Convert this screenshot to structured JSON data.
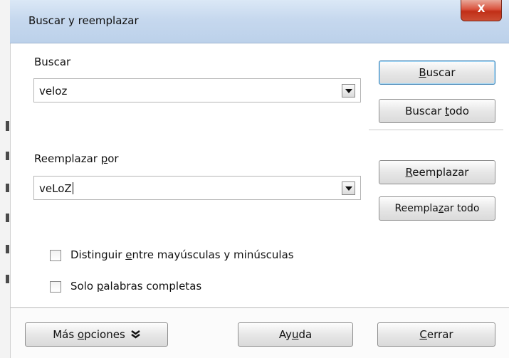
{
  "window": {
    "title": "Buscar y reemplazar",
    "close_glyph": "X"
  },
  "search": {
    "label_before": "Buscar",
    "value": "veloz"
  },
  "replace": {
    "label_before": "Reemplazar ",
    "label_accel": "p",
    "label_after": "or",
    "value": "veLoZ"
  },
  "buttons": {
    "find": {
      "before": "",
      "accel": "B",
      "after": "uscar"
    },
    "find_all": {
      "before": "Buscar ",
      "accel": "t",
      "after": "odo"
    },
    "replace": {
      "before": "",
      "accel": "R",
      "after": "eemplazar"
    },
    "replace_all": {
      "before": "Reempla",
      "accel": "z",
      "after": "ar todo"
    }
  },
  "options": {
    "match_case": {
      "before": "Distinguir ",
      "accel": "e",
      "after": "ntre mayúsculas y minúsculas",
      "checked": false
    },
    "whole_words": {
      "before": "Solo ",
      "accel": "p",
      "after": "alabras completas",
      "checked": false
    }
  },
  "footer": {
    "more_options": {
      "before": "Más ",
      "accel": "o",
      "after": "pciones"
    },
    "help": {
      "before": "Ay",
      "accel": "u",
      "after": "da"
    },
    "close": {
      "before": "",
      "accel": "C",
      "after": "errar"
    }
  },
  "icons": {
    "dropdown": "dropdown-arrow-icon",
    "more_options": "double-chevron-down-icon"
  }
}
